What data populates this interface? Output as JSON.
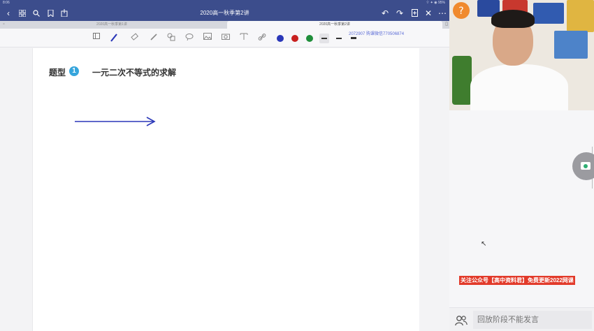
{
  "statusbar": {
    "time": "8:06",
    "right": "⌔ ✦ ◉ 95%"
  },
  "navbar": {
    "title": "2020高一秋季第2讲",
    "left_icons": [
      "back-icon",
      "grid-icon",
      "search-icon",
      "bookmark-icon",
      "share-icon"
    ],
    "right_icons": [
      "undo-icon",
      "redo-icon",
      "add-page-icon",
      "close-icon",
      "more-icon"
    ]
  },
  "tabs": [
    {
      "label": "2020高一秋季第1讲",
      "active": false
    },
    {
      "label": "2020高一秋季第2讲",
      "active": true
    }
  ],
  "watermark": "2072907 购课微信770506874",
  "toolbar": {
    "tools": [
      "sidebar-icon",
      "pen-icon",
      "eraser-icon",
      "highlighter-icon",
      "shapes-icon",
      "lasso-icon",
      "image-icon",
      "camera-icon",
      "text-icon",
      "link-icon"
    ],
    "colors": [
      "#2a37b8",
      "#c8201f",
      "#1f8e3a"
    ]
  },
  "page": {
    "heading": "题型",
    "badge": "1",
    "subtitle": "一元二次不等式的求解"
  },
  "notice": "关注公众号【高中资料君】免费更新2022网课",
  "chat": {
    "placeholder": "回放阶段不能发言"
  }
}
